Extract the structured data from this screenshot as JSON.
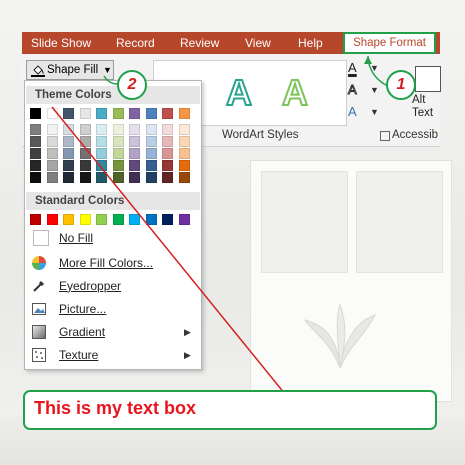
{
  "ribbon": {
    "tabs": [
      {
        "label": "Slide Show"
      },
      {
        "label": "Record"
      },
      {
        "label": "Review"
      },
      {
        "label": "View"
      },
      {
        "label": "Help"
      }
    ],
    "active_tab": {
      "label": "Shape Format"
    },
    "shape_fill_label": "Shape Fill",
    "wordart_styles_label": "WordArt Styles",
    "wordart_sample": "A",
    "text_fill_glyph": "A",
    "alt_text_label": "Alt Text",
    "accessibility_label": "Accessib"
  },
  "dropdown": {
    "theme_colors_label": "Theme Colors",
    "standard_colors_label": "Standard Colors",
    "theme_top_row": [
      "#000000",
      "#ffffff",
      "#44546a",
      "#e7e6e6",
      "#4bacc6",
      "#9bbb59",
      "#8064a2",
      "#4f81bd",
      "#c0504d",
      "#f79646"
    ],
    "theme_columns": [
      [
        "#7f7f7f",
        "#595959",
        "#404040",
        "#262626",
        "#0d0d0d"
      ],
      [
        "#f2f2f2",
        "#d9d9d9",
        "#bfbfbf",
        "#a6a6a6",
        "#7f7f7f"
      ],
      [
        "#d6dce5",
        "#adb9ca",
        "#8497b0",
        "#333f50",
        "#222a35"
      ],
      [
        "#d0cece",
        "#aeabab",
        "#757171",
        "#3a3838",
        "#171616"
      ],
      [
        "#daeef3",
        "#b7dee8",
        "#92cddc",
        "#31859c",
        "#215968"
      ],
      [
        "#ebf1de",
        "#d7e4bd",
        "#c3d69b",
        "#77933c",
        "#4f6228"
      ],
      [
        "#e5e0ec",
        "#ccc1da",
        "#b3a2c7",
        "#604a7b",
        "#403152"
      ],
      [
        "#dce6f2",
        "#b9cde5",
        "#95b3d7",
        "#376092",
        "#244062"
      ],
      [
        "#f2dcdb",
        "#e6b9b8",
        "#d99694",
        "#953735",
        "#632523"
      ],
      [
        "#fde9d9",
        "#fcd5b5",
        "#fac090",
        "#e46c0a",
        "#984807"
      ]
    ],
    "standard_colors": [
      "#c00000",
      "#ff0000",
      "#ffc000",
      "#ffff00",
      "#92d050",
      "#00b050",
      "#00b0f0",
      "#0070c0",
      "#002060",
      "#7030a0"
    ],
    "items": [
      {
        "label": "No Fill"
      },
      {
        "label": "More Fill Colors..."
      },
      {
        "label": "Eyedropper"
      },
      {
        "label": "Picture..."
      },
      {
        "label": "Gradient"
      },
      {
        "label": "Texture"
      }
    ]
  },
  "badges": {
    "step1": "1",
    "step2": "2"
  },
  "textbox": {
    "text": "This is my text box"
  },
  "colors": {
    "ribbon_red": "#b7472a",
    "highlight_green": "#21a04a",
    "annotation_red": "#e8141e"
  }
}
